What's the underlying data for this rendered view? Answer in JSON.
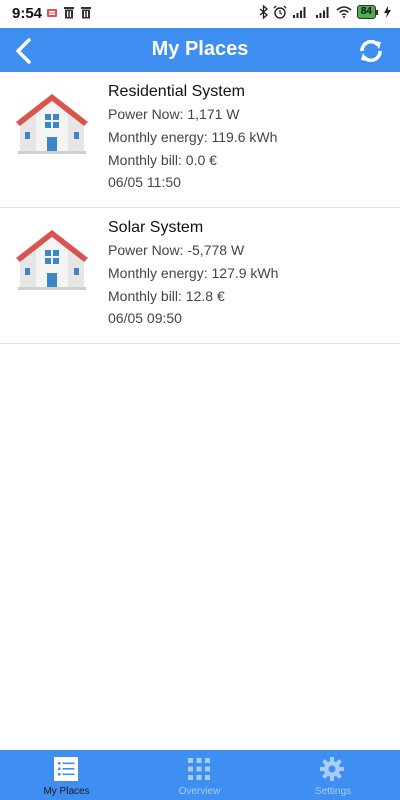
{
  "status": {
    "time": "9:54",
    "battery": "84"
  },
  "header": {
    "title": "My Places"
  },
  "places": [
    {
      "name": "Residential System",
      "power_now": "Power Now: 1,171 W",
      "monthly_energy": "Monthly energy: 119.6 kWh",
      "monthly_bill": "Monthly bill: 0.0 €",
      "timestamp": "06/05 11:50"
    },
    {
      "name": "Solar System",
      "power_now": "Power Now: -5,778 W",
      "monthly_energy": "Monthly energy: 127.9 kWh",
      "monthly_bill": "Monthly bill: 12.8 €",
      "timestamp": "06/05 09:50"
    }
  ],
  "nav": {
    "items": [
      {
        "label": "My Places",
        "icon": "list-icon",
        "active": true
      },
      {
        "label": "Overview",
        "icon": "grid-icon",
        "active": false
      },
      {
        "label": "Settings",
        "icon": "gear-icon",
        "active": false
      }
    ]
  },
  "colors": {
    "primary": "#3f8ef2",
    "roof": "#d9534f",
    "window": "#3b86c7",
    "active_nav_label": "#1a1a1a",
    "inactive_nav_label": "#a8cdf8"
  }
}
